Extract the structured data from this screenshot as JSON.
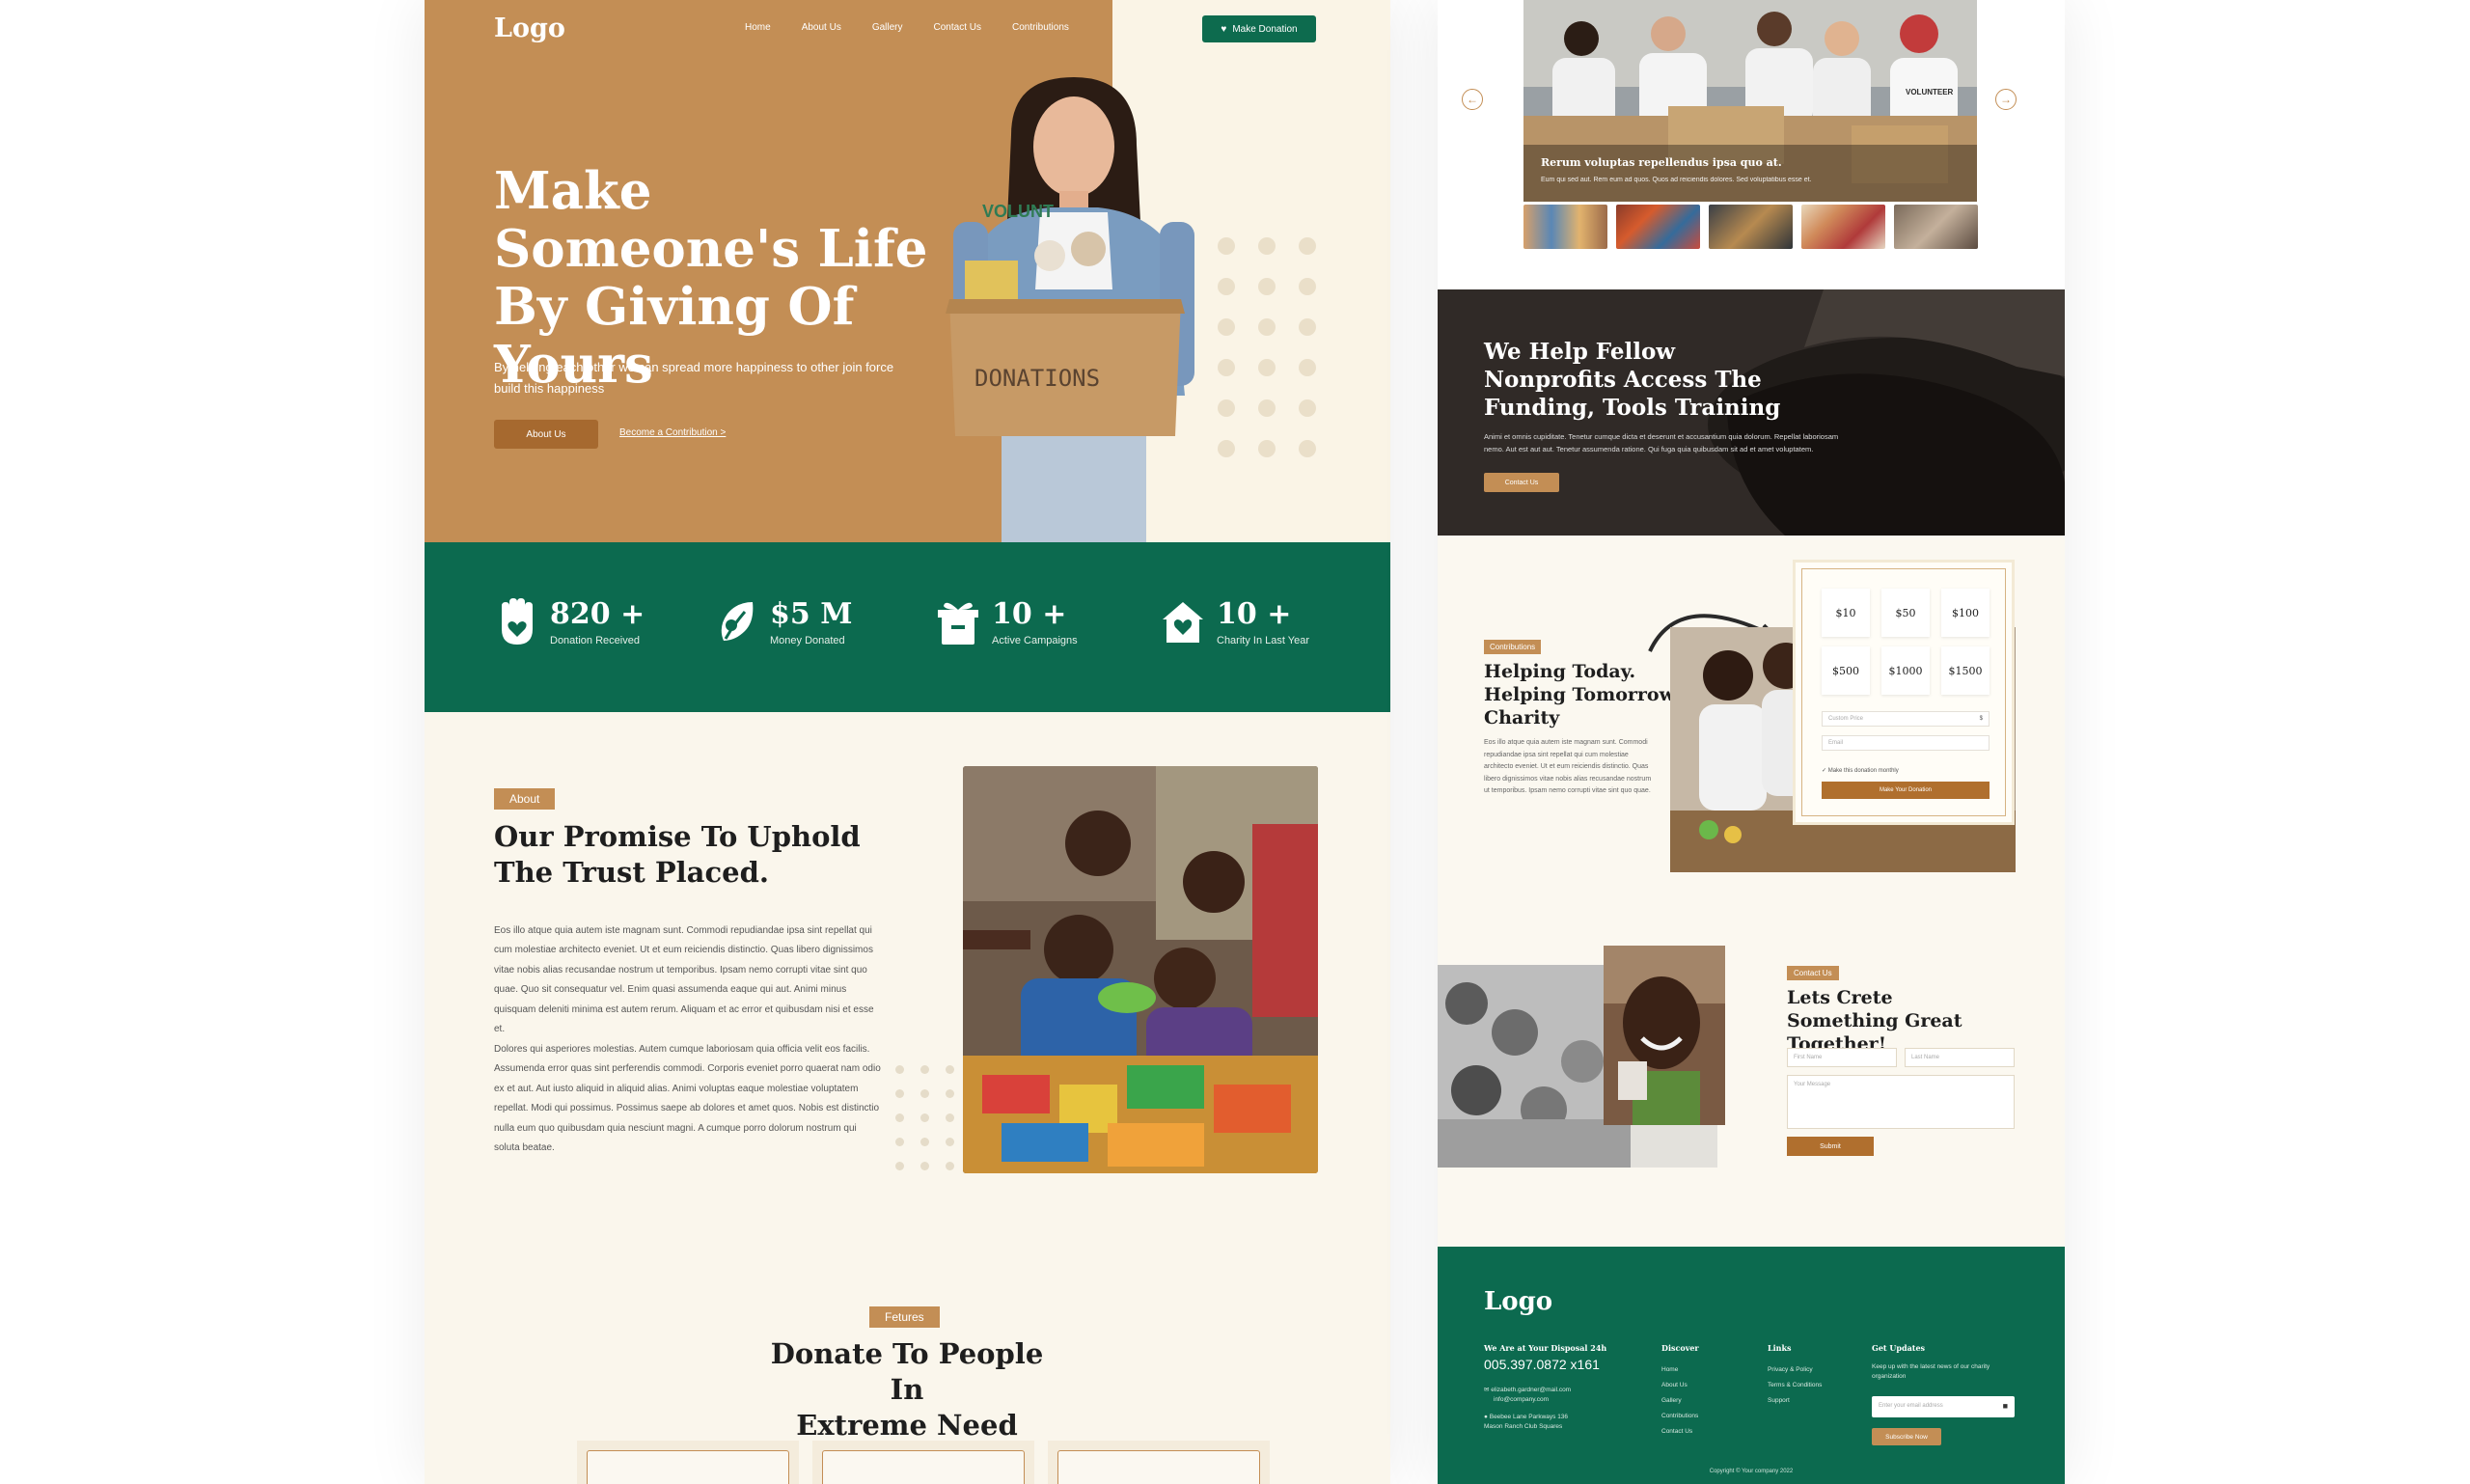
{
  "colors": {
    "accent": "#c38e55",
    "brand_green": "#0c6a4f",
    "cream": "#faf6ec"
  },
  "header": {
    "logo": "Logo",
    "nav": [
      "Home",
      "About Us",
      "Gallery",
      "Contact Us",
      "Contributions"
    ],
    "donate_button": "Make Donation"
  },
  "hero": {
    "title": "Make Someone's Life By Giving Of Yours",
    "subtitle": "By helping each other we can spread more happiness to other join force build this happiness",
    "about_button": "About Us",
    "contribution_link": "Become a Contribution >",
    "box_label": "DONATIONS",
    "shirt_text": "VOLUNT"
  },
  "stats": [
    {
      "value": "820 +",
      "label": "Donation Received",
      "icon": "hand-heart-icon"
    },
    {
      "value": "$5 M",
      "label": "Money Donated",
      "icon": "leaf-coin-icon"
    },
    {
      "value": "10 +",
      "label": "Active Campaigns",
      "icon": "gift-box-icon"
    },
    {
      "value": "10 +",
      "label": "Charity In Last Year",
      "icon": "house-heart-icon"
    }
  ],
  "about": {
    "tag": "About",
    "title_line1": "Our Promise To Uphold",
    "title_line2": "The Trust Placed.",
    "paragraph1": "Eos illo atque quia autem iste magnam sunt. Commodi repudiandae ipsa sint repellat qui cum molestiae architecto eveniet. Ut et eum reiciendis distinctio. Quas libero dignissimos vitae nobis alias recusandae nostrum ut temporibus. Ipsam nemo corrupti vitae sint quo quae. Quo sit consequatur vel. Enim quasi assumenda eaque qui aut. Animi minus quisquam deleniti minima est autem rerum. Aliquam et ac error et quibusdam nisi et esse et.",
    "paragraph2": "Dolores qui asperiores molestias. Autem cumque laboriosam quia officia velit eos facilis. Assumenda error quas sint perferendis commodi. Corporis eveniet porro quaerat nam odio ex et aut. Aut iusto aliquid in aliquid alias. Animi voluptas eaque molestiae voluptatem repellat. Modi qui possimus. Possimus saepe ab dolores et amet quos. Nobis est distinctio nulla eum quo quibusdam quia nesciunt magni. A cumque porro dolorum nostrum qui soluta beatae."
  },
  "features": {
    "tag": "Fetures",
    "title_line1": "Donate To People In",
    "title_line2": "Extreme Need"
  },
  "gallery": {
    "caption_title": "Rerum voluptas repellendus ipsa quo at.",
    "caption_sub": "Eum qui sed aut. Rem eum ad quos. Quos ad reiciendis dolores. Sed voluptatibus esse et.",
    "shirt_text": "VOLUNTEER",
    "prev": "←",
    "next": "→"
  },
  "nonprofit": {
    "title": "We Help Fellow Nonprofits Access The Funding, Tools Training",
    "text": "Animi et omnis cupiditate. Tenetur cumque dicta et deserunt et accusantium quia dolorum. Repellat laboriosam nemo. Aut est aut aut. Tenetur assumenda ratione. Qui fuga quia quibusdam sit ad et amet voluptatem.",
    "button": "Contact Us"
  },
  "contributions": {
    "tag": "Contributions",
    "title": "Helping Today. Helping Tomorrow Charity",
    "text": "Eos illo atque quia autem iste magnam sunt. Commodi repudiandae ipsa sint repellat qui cum molestiae architecto eveniet. Ut et eum reiciendis distinctio. Quas libero dignissimos vitae nobis alias recusandae nostrum ut temporibus. Ipsam nemo corrupti vitae sint quo quae.",
    "amounts": [
      "$10",
      "$50",
      "$100",
      "$500",
      "$1000",
      "$1500"
    ],
    "custom_placeholder": "Custom Price",
    "currency_symbol": "$",
    "name_placeholder": "Email",
    "checkbox_label": "Make this donation monthly",
    "submit": "Make Your Donation"
  },
  "contact": {
    "tag": "Contact Us",
    "title": "Lets Crete Something Great Together!",
    "first_name": "First Name",
    "last_name": "Last Name",
    "message": "Your Message",
    "submit": "Submit"
  },
  "footer": {
    "logo": "Logo",
    "disposal_heading": "We Are at Your Disposal 24h",
    "phone": "005.397.0872 x161",
    "email_lines": [
      "elizabeth.gardner@mail.com",
      "info@company.com"
    ],
    "address": "Beebee Lane Parkways 136 Mason Ranch Club Squares",
    "discover_heading": "Discover",
    "discover_links": [
      "Home",
      "About Us",
      "Gallery",
      "Contributions",
      "Contact Us"
    ],
    "links_heading": "Links",
    "links": [
      "Privacy & Policy",
      "Terms & Conditions",
      "Support"
    ],
    "updates_heading": "Get Updates",
    "updates_text": "Keep up with the latest news of our charity organization",
    "email_placeholder": "Enter your email address",
    "subscribe": "Subscribe Now",
    "copyright": "Copyright © Your company 2022"
  }
}
